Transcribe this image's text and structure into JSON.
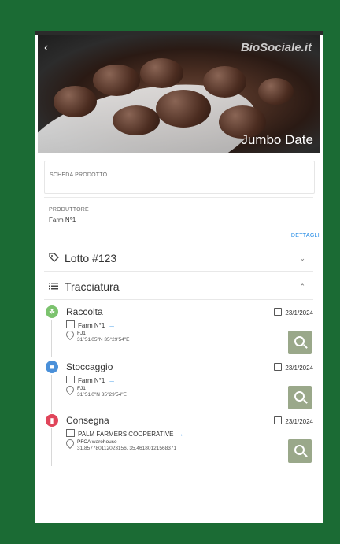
{
  "hero": {
    "brand": "BioSociale.it",
    "title": "Jumbo Date",
    "back_icon": "chevron-left-icon"
  },
  "scheda": {
    "label": "SCHEDA PRODOTTO"
  },
  "produttore": {
    "label": "PRODUTTORE",
    "value": "Farm N°1",
    "details_link": "DETTAGLI"
  },
  "lotto": {
    "icon": "tag-icon",
    "title": "Lotto #123",
    "chevron": "chevron-down-icon"
  },
  "tracciatura": {
    "icon": "list-icon",
    "title": "Tracciatura",
    "chevron": "chevron-up-icon"
  },
  "steps": [
    {
      "name": "Raccolta",
      "color": "#7cc36e",
      "icon": "harvest-icon",
      "date": "23/1/2024",
      "farm": "Farm N°1",
      "place": "FJ1",
      "coords": "31°51'05\"N 35°29'54\"E"
    },
    {
      "name": "Stoccaggio",
      "color": "#4a90d9",
      "icon": "warehouse-icon",
      "date": "23/1/2024",
      "farm": "Farm N°1",
      "place": "FJ1",
      "coords": "31°51'0\"N 35°29'54\"E"
    },
    {
      "name": "Consegna",
      "color": "#e0455a",
      "icon": "truck-icon",
      "date": "23/1/2024",
      "farm": "PALM FARMERS COOPERATIVE",
      "place": "PFCA warehouse",
      "coords": "31.857780112023156, 35.46180121568371"
    }
  ]
}
